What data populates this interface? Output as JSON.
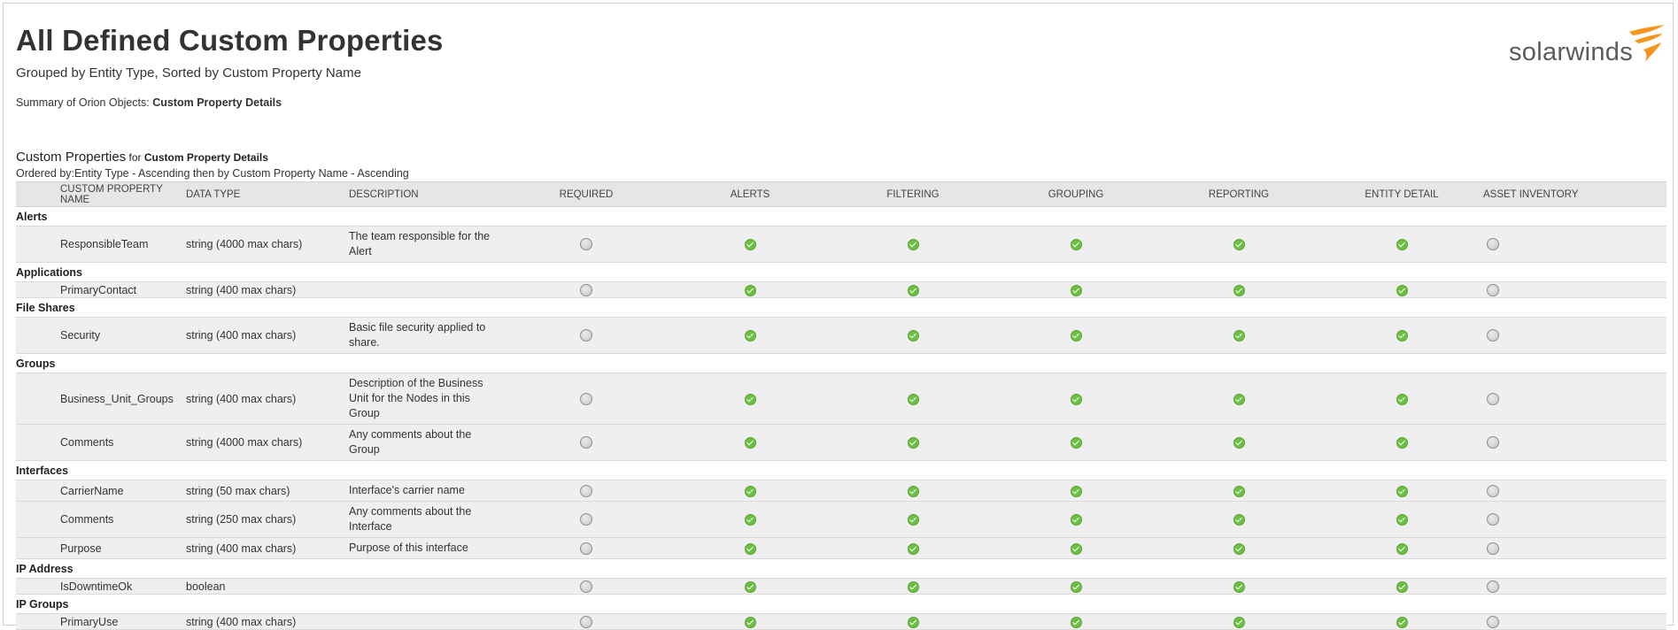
{
  "header": {
    "title": "All Defined Custom Properties",
    "subtitle": "Grouped by Entity Type, Sorted by Custom Property Name",
    "summary_prefix": "Summary of Orion Objects: ",
    "summary_value": "Custom Property Details",
    "logo_text": "solarwinds"
  },
  "section": {
    "title": "Custom Properties",
    "for_text": " for ",
    "for_value": "Custom Property Details",
    "order_line": "Ordered by:Entity Type - Ascending then by Custom Property Name - Ascending"
  },
  "columns": [
    "CUSTOM PROPERTY NAME",
    "DATA TYPE",
    "DESCRIPTION",
    "REQUIRED",
    "ALERTS",
    "FILTERING",
    "GROUPING",
    "REPORTING",
    "ENTITY DETAIL",
    "ASSET INVENTORY"
  ],
  "groups": [
    {
      "label": "Alerts",
      "rows": [
        {
          "name": "ResponsibleTeam",
          "type": "string (4000 max chars)",
          "desc": "The team responsible for the Alert",
          "flags": [
            false,
            true,
            true,
            true,
            true,
            true,
            false
          ]
        }
      ]
    },
    {
      "label": "Applications",
      "rows": [
        {
          "name": "PrimaryContact",
          "type": "string (400 max chars)",
          "desc": "",
          "flags": [
            false,
            true,
            true,
            true,
            true,
            true,
            false
          ]
        }
      ]
    },
    {
      "label": "File Shares",
      "rows": [
        {
          "name": "Security",
          "type": "string (400 max chars)",
          "desc": "Basic file security applied to share.",
          "flags": [
            false,
            true,
            true,
            true,
            true,
            true,
            false
          ]
        }
      ]
    },
    {
      "label": "Groups",
      "rows": [
        {
          "name": "Business_Unit_Groups",
          "type": "string (400 max chars)",
          "desc": "Description of the Business Unit for the Nodes in this Group",
          "flags": [
            false,
            true,
            true,
            true,
            true,
            true,
            false
          ]
        },
        {
          "name": "Comments",
          "type": "string (4000 max chars)",
          "desc": "Any comments about the Group",
          "flags": [
            false,
            true,
            true,
            true,
            true,
            true,
            false
          ]
        }
      ]
    },
    {
      "label": "Interfaces",
      "rows": [
        {
          "name": "CarrierName",
          "type": "string (50 max chars)",
          "desc": "Interface's carrier name",
          "flags": [
            false,
            true,
            true,
            true,
            true,
            true,
            false
          ]
        },
        {
          "name": "Comments",
          "type": "string (250 max chars)",
          "desc": "Any comments about the Interface",
          "flags": [
            false,
            true,
            true,
            true,
            true,
            true,
            false
          ]
        },
        {
          "name": "Purpose",
          "type": "string (400 max chars)",
          "desc": "Purpose of this interface",
          "flags": [
            false,
            true,
            true,
            true,
            true,
            true,
            false
          ]
        }
      ]
    },
    {
      "label": "IP Address",
      "rows": [
        {
          "name": "IsDowntimeOk",
          "type": "boolean",
          "desc": "",
          "flags": [
            false,
            true,
            true,
            true,
            true,
            true,
            false
          ]
        }
      ]
    },
    {
      "label": "IP Groups",
      "rows": [
        {
          "name": "PrimaryUse",
          "type": "string (400 max chars)",
          "desc": "",
          "flags": [
            false,
            true,
            true,
            true,
            true,
            true,
            false
          ]
        }
      ]
    }
  ],
  "colors": {
    "check": "#6fbe44",
    "header_bg": "#e6e6e6",
    "row_bg": "#efefef",
    "logo_orange": "#f7941d"
  }
}
